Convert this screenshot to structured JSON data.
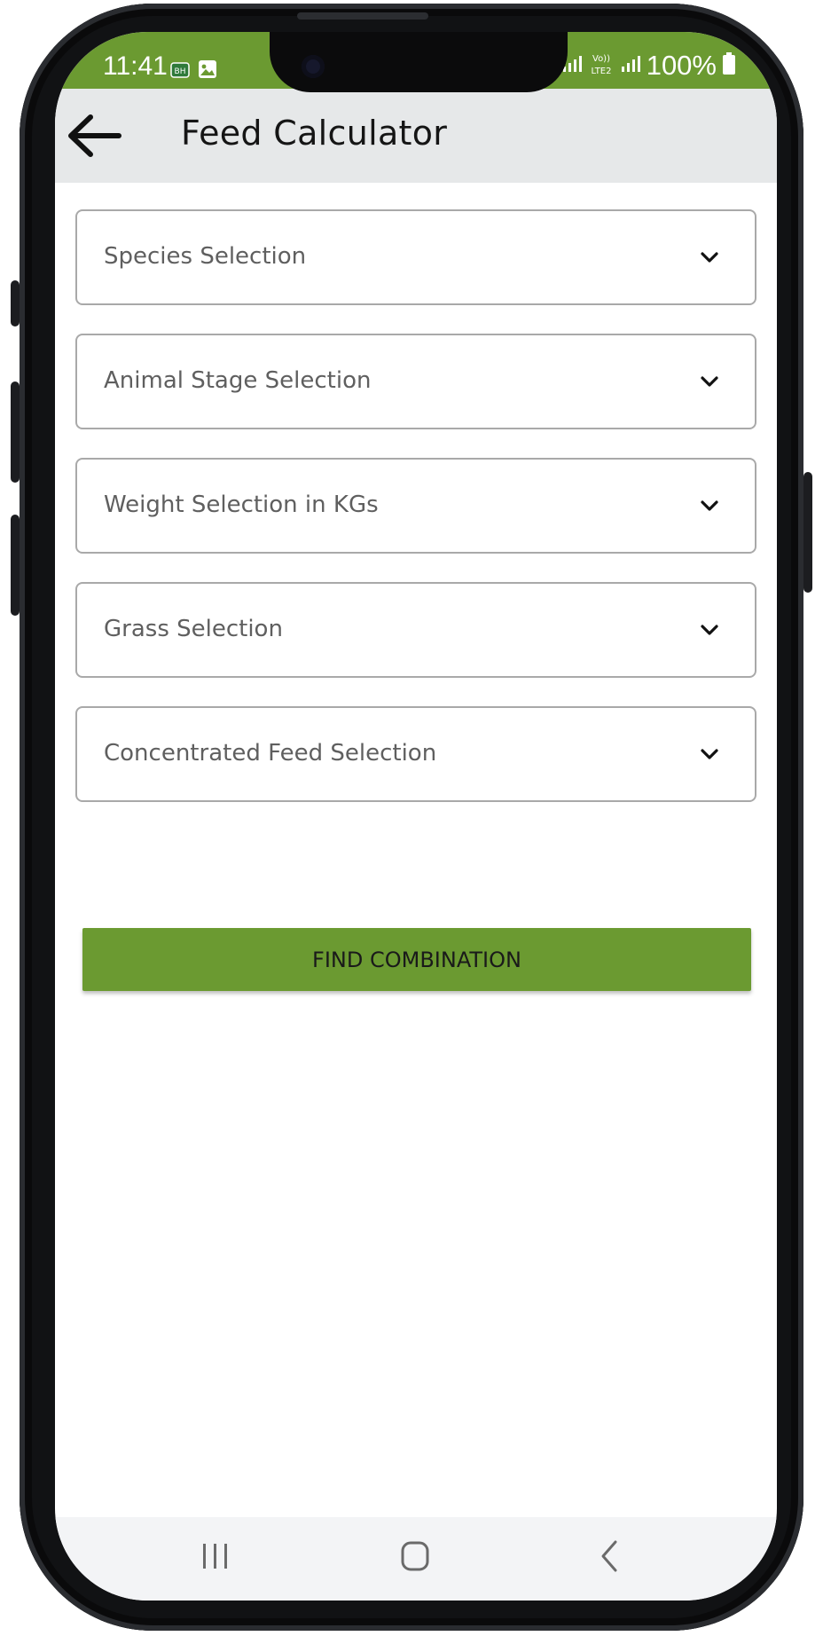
{
  "status_bar": {
    "time": "11:41",
    "notification_icons": [
      "carrier-badge-icon",
      "gallery-icon"
    ],
    "carrier_badge": "BH",
    "signal_icons": [
      "signal-icon",
      "volte-lte2-icon",
      "signal-icon"
    ],
    "volte_label": "Vo))",
    "lte_label": "LTE2",
    "battery_percent": "100%",
    "battery_icon": "battery-full-icon",
    "color": "#6b9a31"
  },
  "app_bar": {
    "title": "Feed Calculator",
    "back_icon": "arrow-left-icon",
    "background": "#e6e8e9"
  },
  "form": {
    "dropdowns": [
      {
        "label": "Species Selection",
        "icon": "chevron-down-icon"
      },
      {
        "label": "Animal Stage Selection",
        "icon": "chevron-down-icon"
      },
      {
        "label": "Weight Selection in KGs",
        "icon": "chevron-down-icon"
      },
      {
        "label": "Grass Selection",
        "icon": "chevron-down-icon"
      },
      {
        "label": "Concentrated Feed Selection",
        "icon": "chevron-down-icon"
      }
    ],
    "find_button": {
      "label": "FIND COMBINATION",
      "color": "#6b9a31"
    }
  },
  "nav_bar": {
    "items": [
      "recent-apps-icon",
      "home-icon",
      "back-icon"
    ]
  }
}
